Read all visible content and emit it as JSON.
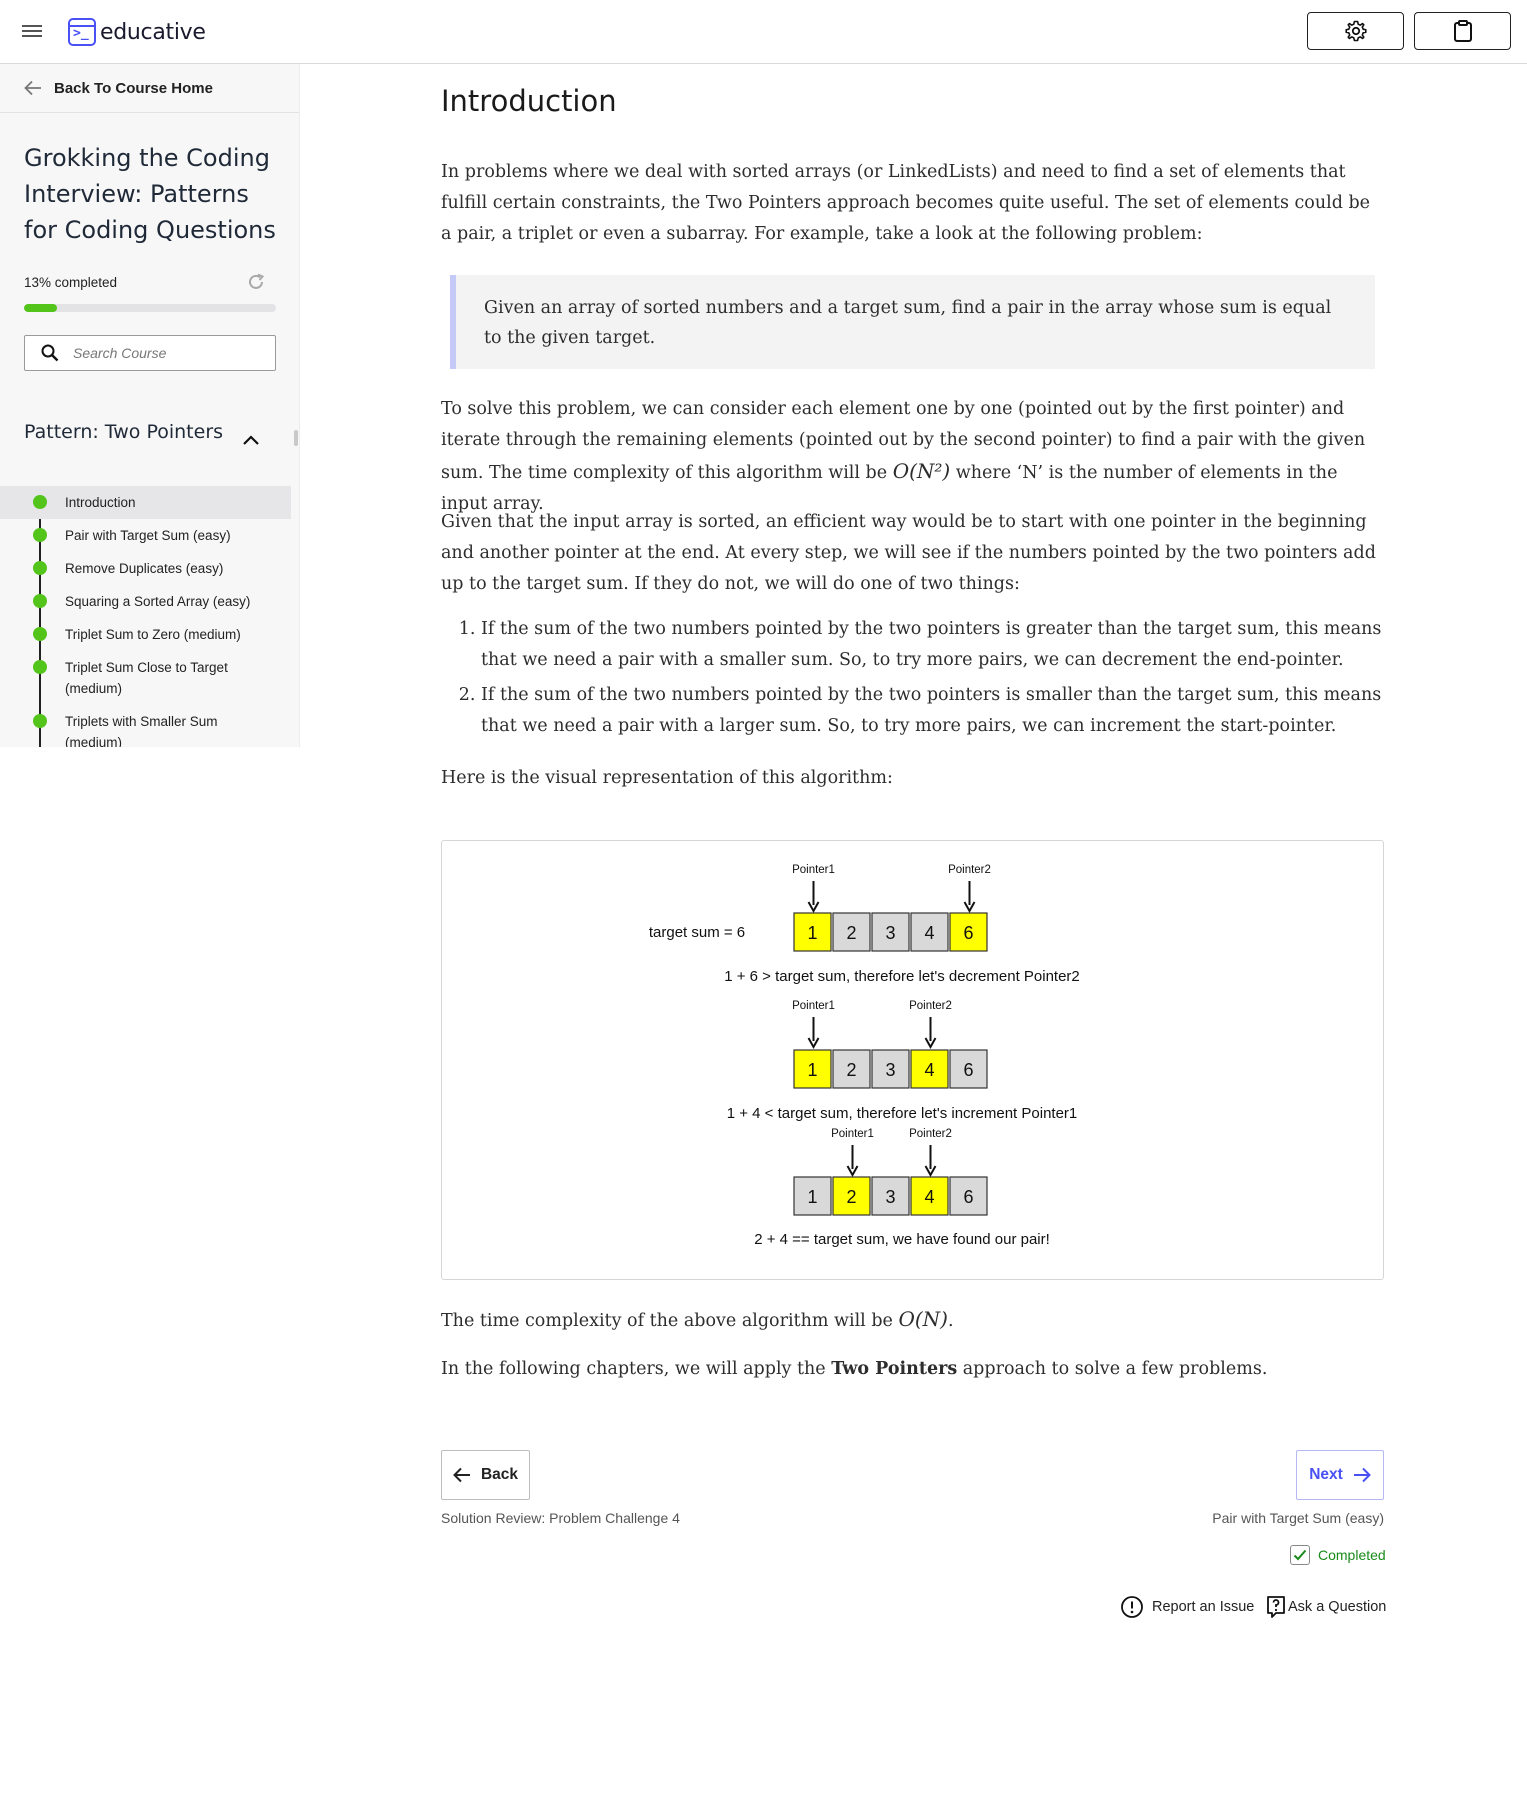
{
  "header": {
    "logo_text": "educative",
    "icons": [
      "menu-icon",
      "settings-icon",
      "clipboard-icon"
    ]
  },
  "sidebar": {
    "back_label": "Back To Course Home",
    "course_title": "Grokking the Coding Interview: Patterns for Coding Questions",
    "progress_text": "13% completed",
    "progress_fraction": 0.13,
    "search_placeholder": "Search Course",
    "section_title": "Pattern: Two Pointers",
    "lessons": [
      {
        "label": "Introduction",
        "active": true
      },
      {
        "label": "Pair with Target Sum (easy)",
        "active": false
      },
      {
        "label": "Remove Duplicates (easy)",
        "active": false
      },
      {
        "label": "Squaring a Sorted Array (easy)",
        "active": false
      },
      {
        "label": "Triplet Sum to Zero (medium)",
        "active": false
      },
      {
        "label": "Triplet Sum Close to Target (medium)",
        "active": false
      },
      {
        "label": "Triplets with Smaller Sum (medium)",
        "active": false
      }
    ]
  },
  "main": {
    "title": "Introduction",
    "para1": "In problems where we deal with sorted arrays (or LinkedLists) and need to find a set of elements that fulfill certain constraints, the Two Pointers approach becomes quite useful. The set of elements could be a pair, a triplet or even a subarray. For example, take a look at the following problem:",
    "quote": "Given an array of sorted numbers and a target sum, find a pair in the array whose sum is equal to the given target.",
    "para2_a": "To solve this problem, we can consider each element one by one (pointed out by the first pointer) and iterate through the remaining elements (pointed out by the second pointer) to find a pair with the given sum. The time complexity of this algorithm will be ",
    "para2_math": "O(N²)",
    "para2_b": " where ‘N’ is the number of elements in the input array.",
    "para3": "Given that the input array is sorted, an efficient way would be to start with one pointer in the beginning and another pointer at the end. At every step, we will see if the numbers pointed by the two pointers add up to the target sum. If they do not, we will do one of two things:",
    "steps": [
      "If the sum of the two numbers pointed by the two pointers is greater than the target sum, this means that we need a pair with a smaller sum. So, to try more pairs, we can decrement the end-pointer.",
      "If the sum of the two numbers pointed by the two pointers is smaller than the target sum, this means that we need a pair with a larger sum. So, to try more pairs, we can increment the start-pointer."
    ],
    "para4": "Here is the visual representation of this algorithm:",
    "para5_a": "The time complexity of the above algorithm will be ",
    "para5_math": "O(N)",
    "para5_b": ".",
    "para6_a": "In the following chapters, we will apply the ",
    "para6_bold": "Two Pointers",
    "para6_b": " approach to solve a few problems."
  },
  "diagram": {
    "target_label": "target sum = 6",
    "array": [
      "1",
      "2",
      "3",
      "4",
      "6"
    ],
    "highlight_color": "#ffff00",
    "cell_color": "#d9d9d9",
    "pointer1_label": "Pointer1",
    "pointer2_label": "Pointer2",
    "rows": [
      {
        "p1": 0,
        "p2": 4,
        "caption": "1 + 6 > target sum, therefore let's decrement Pointer2"
      },
      {
        "p1": 0,
        "p2": 3,
        "caption": "1 + 4 < target sum, therefore let's increment Pointer1"
      },
      {
        "p1": 1,
        "p2": 3,
        "caption": "2 + 4 == target sum, we have found our pair!"
      }
    ]
  },
  "nav": {
    "back_label": "Back",
    "next_label": "Next",
    "prev_lesson": "Solution Review: Problem Challenge 4",
    "next_lesson": "Pair with Target Sum (easy)",
    "completed_label": "Completed",
    "report_label": "Report an Issue",
    "ask_label": "Ask a Question"
  }
}
